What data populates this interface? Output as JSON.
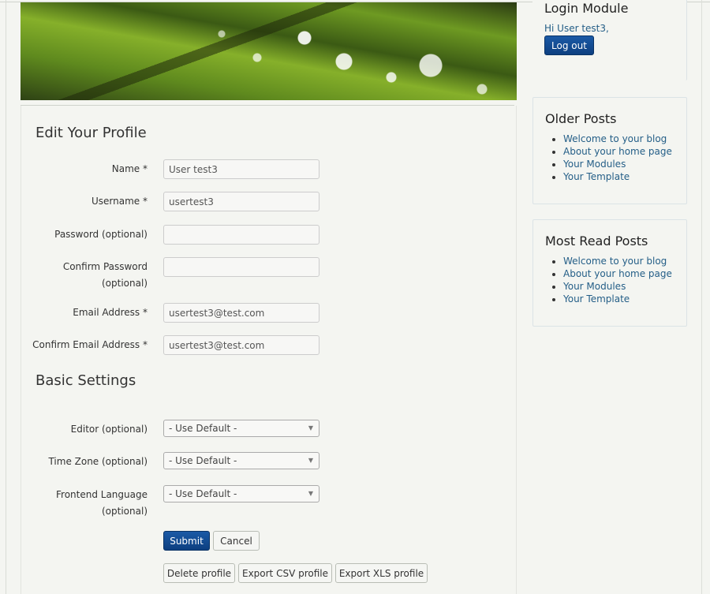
{
  "profile": {
    "title": "Edit Your Profile",
    "fields": [
      {
        "label": "Name *",
        "value": "User test3"
      },
      {
        "label": "Username *",
        "value": "usertest3"
      },
      {
        "label": "Password (optional)",
        "value": ""
      },
      {
        "label_line1": "Confirm Password",
        "label_line2": "(optional)",
        "value": ""
      },
      {
        "label": "Email Address *",
        "value": "usertest3@test.com"
      },
      {
        "label": "Confirm Email Address *",
        "value": "usertest3@test.com"
      }
    ]
  },
  "basic_settings": {
    "title": "Basic Settings",
    "fields": [
      {
        "label": "Editor (optional)",
        "value": "- Use Default -"
      },
      {
        "label": "Time Zone (optional)",
        "value": "- Use Default -"
      },
      {
        "label_line1": "Frontend Language",
        "label_line2": "(optional)",
        "value": "- Use Default -"
      }
    ]
  },
  "actions": {
    "submit": "Submit",
    "cancel": "Cancel",
    "delete": "Delete profile",
    "export_csv": "Export CSV profile",
    "export_xls": "Export XLS profile"
  },
  "login_module": {
    "title": "Login Module",
    "greeting": "Hi User test3,",
    "logout": "Log out"
  },
  "older_posts": {
    "title": "Older Posts",
    "items": [
      "Welcome to your blog",
      "About your home page",
      "Your Modules",
      "Your Template"
    ]
  },
  "most_read": {
    "title": "Most Read Posts",
    "items": [
      "Welcome to your blog",
      "About your home page",
      "Your Modules",
      "Your Template"
    ]
  },
  "colors": {
    "primary_button": "#0d3f80",
    "link": "#245e87",
    "background": "#f4f5f1"
  }
}
